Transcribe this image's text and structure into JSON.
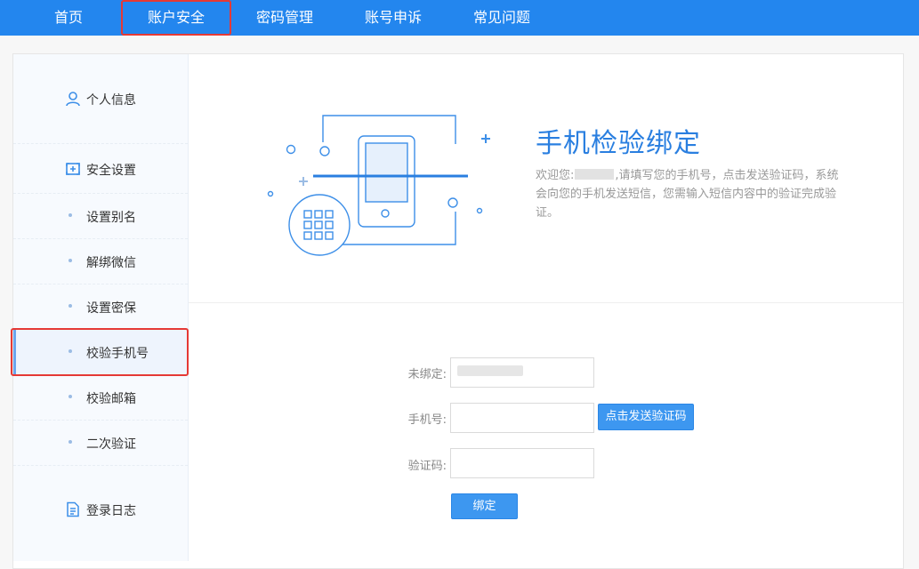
{
  "nav": {
    "items": [
      {
        "label": "首页"
      },
      {
        "label": "账户安全"
      },
      {
        "label": "密码管理"
      },
      {
        "label": "账号申诉"
      },
      {
        "label": "常见问题"
      }
    ],
    "active_index": 1
  },
  "sidebar": {
    "items": [
      {
        "label": "个人信息",
        "icon": "user-icon"
      },
      {
        "label": "安全设置",
        "icon": "shield-plus-icon"
      },
      {
        "label": "设置别名",
        "icon": "dot"
      },
      {
        "label": "解绑微信",
        "icon": "dot"
      },
      {
        "label": "设置密保",
        "icon": "dot"
      },
      {
        "label": "校验手机号",
        "icon": "dot"
      },
      {
        "label": "校验邮箱",
        "icon": "dot"
      },
      {
        "label": "二次验证",
        "icon": "dot"
      },
      {
        "label": "登录日志",
        "icon": "document-icon"
      }
    ],
    "active_index": 5
  },
  "hero": {
    "title": "手机检验绑定",
    "desc_prefix": "欢迎您:",
    "desc_suffix": ",请填写您的手机号，点击发送验证码，系统会向您的手机发送短信，您需输入短信内容中的验证完成验证。"
  },
  "form": {
    "unbound_label": "未绑定:",
    "phone_label": "手机号:",
    "phone_value": "",
    "code_label": "验证码:",
    "code_value": "",
    "send_code_button": "点击发送验证码",
    "submit_button": "绑定"
  },
  "colors": {
    "nav_bg": "#2386ee",
    "accent": "#2a7fe0",
    "highlight": "#e53935"
  }
}
